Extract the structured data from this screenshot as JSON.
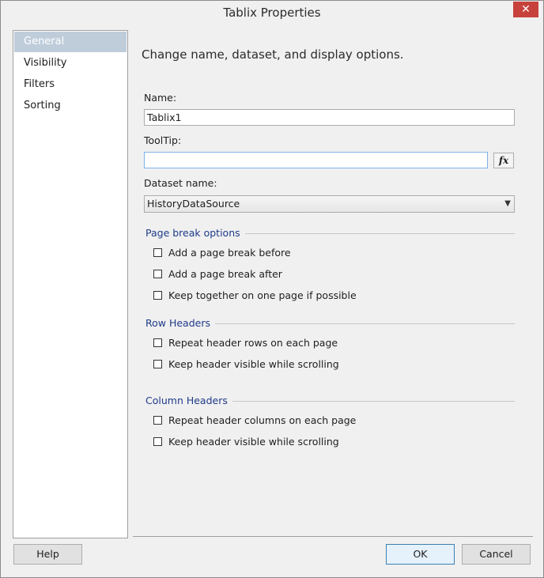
{
  "window": {
    "title": "Tablix Properties",
    "close_glyph": "✕"
  },
  "nav": {
    "items": [
      {
        "label": "General",
        "selected": true
      },
      {
        "label": "Visibility",
        "selected": false
      },
      {
        "label": "Filters",
        "selected": false
      },
      {
        "label": "Sorting",
        "selected": false
      }
    ]
  },
  "main": {
    "heading": "Change name, dataset, and display options.",
    "name_label": "Name:",
    "name_value": "Tablix1",
    "tooltip_label": "ToolTip:",
    "tooltip_value": "",
    "fx_label": "fx",
    "dataset_label": "Dataset name:",
    "dataset_value": "HistoryDataSource",
    "page_break": {
      "title": "Page break options",
      "options": [
        "Add a page break before",
        "Add a page break after",
        "Keep together on one page if possible"
      ]
    },
    "row_headers": {
      "title": "Row Headers",
      "options": [
        "Repeat header rows on each page",
        "Keep header visible while scrolling"
      ]
    },
    "column_headers": {
      "title": "Column Headers",
      "options": [
        "Repeat header columns on each page",
        "Keep header visible while scrolling"
      ]
    }
  },
  "footer": {
    "help_label": "Help",
    "ok_label": "OK",
    "cancel_label": "Cancel"
  },
  "colors": {
    "selected_nav_bg": "#bfcddb",
    "group_title": "#1f3b8a",
    "close_button": "#c7423b"
  }
}
